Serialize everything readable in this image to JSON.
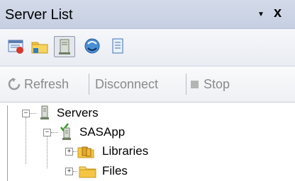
{
  "panel": {
    "title": "Server List",
    "pin_glyph": "▼",
    "close_glyph": "x"
  },
  "view_toolbar": {
    "buttons": [
      {
        "name": "server-list-view-icon",
        "active": false
      },
      {
        "name": "folder-view-icon",
        "active": false
      },
      {
        "name": "server-view-icon",
        "active": true
      },
      {
        "name": "connect-view-icon",
        "active": false
      },
      {
        "name": "properties-view-icon",
        "active": false
      }
    ]
  },
  "action_toolbar": {
    "refresh_label": "Refresh",
    "disconnect_label": "Disconnect",
    "stop_label": "Stop"
  },
  "tree": {
    "servers_label": "Servers",
    "sasapp_label": "SASApp",
    "libraries_label": "Libraries",
    "files_label": "Files",
    "expanded_glyph": "−",
    "collapsed_glyph": "+"
  },
  "colors": {
    "titlebar": "#c6cfe2",
    "folder": "#f5c544",
    "server": "#6f7f63",
    "check": "#2e9d22"
  }
}
